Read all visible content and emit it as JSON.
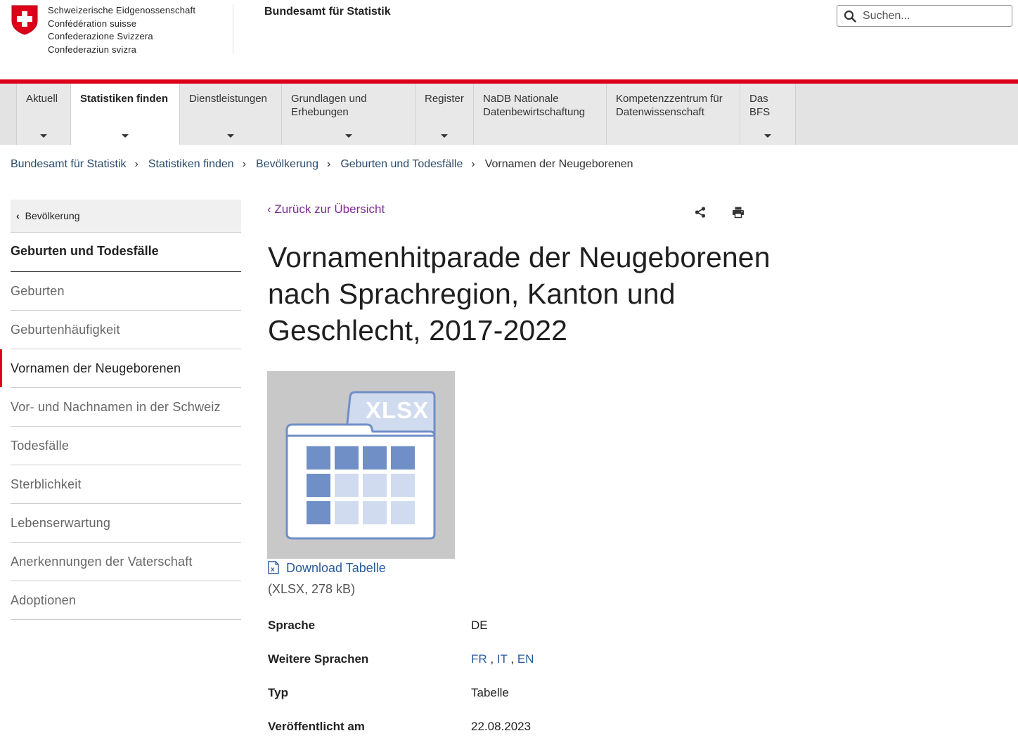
{
  "header": {
    "confederation": [
      "Schweizerische Eidgenossenschaft",
      "Confédération suisse",
      "Confederazione Svizzera",
      "Confederaziun svizra"
    ],
    "office_title": "Bundesamt für Statistik",
    "search_placeholder": "Suchen..."
  },
  "nav": {
    "items": [
      {
        "label": "Aktuell",
        "has_dropdown": true
      },
      {
        "label": "Statistiken finden",
        "has_dropdown": true,
        "active": true
      },
      {
        "label": "Dienstleistungen",
        "has_dropdown": true
      },
      {
        "label": "Grundlagen und Erhebungen",
        "has_dropdown": true
      },
      {
        "label": "Register",
        "has_dropdown": true
      },
      {
        "label": "NaDB Nationale Datenbewirtschaftung",
        "has_dropdown": false
      },
      {
        "label": "Kompetenzzentrum für Datenwissenschaft",
        "has_dropdown": false
      },
      {
        "label": "Das BFS",
        "has_dropdown": true
      }
    ]
  },
  "breadcrumb": {
    "items": [
      "Bundesamt für Statistik",
      "Statistiken finden",
      "Bevölkerung",
      "Geburten und Todesfälle"
    ],
    "current": "Vornamen der Neugeborenen"
  },
  "sidebar": {
    "back_label": "Bevölkerung",
    "section_title": "Geburten und Todesfälle",
    "items": [
      {
        "label": "Geburten"
      },
      {
        "label": "Geburtenhäufigkeit"
      },
      {
        "label": "Vornamen der Neugeborenen",
        "active": true
      },
      {
        "label": "Vor- und Nachnamen in der Schweiz"
      },
      {
        "label": "Todesfälle"
      },
      {
        "label": "Sterblichkeit"
      },
      {
        "label": "Lebenserwartung"
      },
      {
        "label": "Anerkennungen der Vaterschaft"
      },
      {
        "label": "Adoptionen"
      }
    ]
  },
  "main": {
    "back_link": "Zurück zur Übersicht",
    "title": "Vornamenhitparade der Neugeborenen nach Sprachregion, Kanton und Geschlecht, 2017-2022",
    "thumbnail_label": "XLSX",
    "download_label": "Download Tabelle",
    "file_info": "(XLSX, 278 kB)",
    "metadata": {
      "sprache_label": "Sprache",
      "sprache_value": "DE",
      "weitere_label": "Weitere Sprachen",
      "weitere_values": [
        "FR",
        "IT",
        "EN"
      ],
      "typ_label": "Typ",
      "typ_value": "Tabelle",
      "veroeffentlicht_label": "Veröffentlicht am",
      "veroeffentlicht_value": "22.08.2023"
    }
  },
  "colors": {
    "swiss_red": "#dc0018",
    "link_blue": "#2a5b9a",
    "back_link_purple": "#7a2c8f",
    "nav_bg": "#e8e8e8",
    "thumb_bg": "#c8c8c8",
    "table_dark": "#6f8fc6",
    "table_light": "#d1dbef"
  },
  "icons": {
    "search": "search-icon",
    "share": "share-icon",
    "print": "print-icon",
    "excel": "excel-file-icon",
    "back_chevron": "chevron-left-icon"
  }
}
